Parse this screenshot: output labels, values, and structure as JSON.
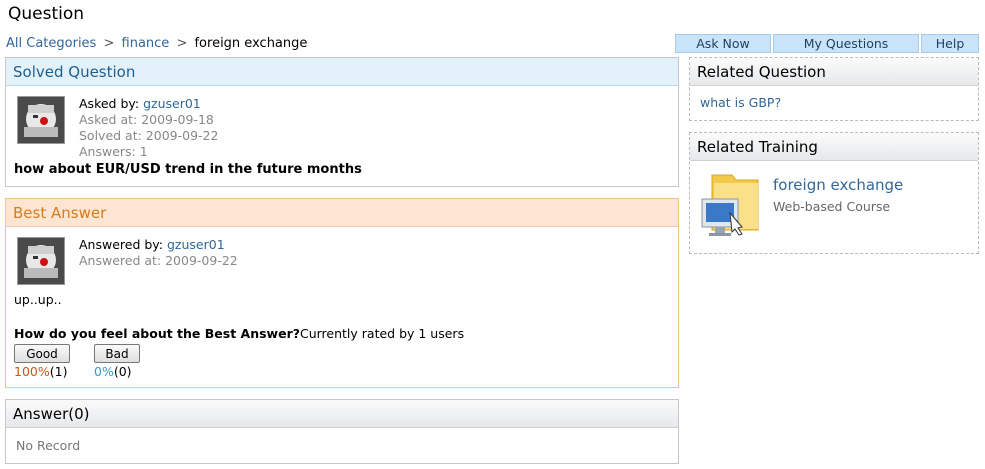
{
  "page": {
    "title": "Question"
  },
  "breadcrumb": {
    "items": [
      "All Categories",
      "finance"
    ],
    "separator": ">",
    "current": "foreign exchange"
  },
  "topnav": {
    "tabs": [
      "Ask Now",
      "My Questions",
      "Help"
    ]
  },
  "question": {
    "header": "Solved Question",
    "asked_by_label": "Asked by:",
    "asked_by_user": "gzuser01",
    "asked_at": "Asked at: 2009-09-18",
    "solved_at": "Solved at: 2009-09-22",
    "answers": "Answers: 1",
    "text": "how about EUR/USD trend in the future months"
  },
  "best_answer": {
    "header": "Best Answer",
    "answered_by_label": "Answered by:",
    "answered_by_user": "gzuser01",
    "answered_at": "Answered at: 2009-09-22",
    "text": "up..up..",
    "rating_question": "How do you feel about the Best Answer?",
    "rating_count": "Currently rated by 1 users",
    "good_label": "Good",
    "good_pct": "100%",
    "good_count": "(1)",
    "bad_label": "Bad",
    "bad_pct": "0%",
    "bad_count": "(0)"
  },
  "answers": {
    "header": "Answer(0)",
    "empty": "No Record"
  },
  "related_question": {
    "header": "Related Question",
    "items": [
      "what is GBP?"
    ]
  },
  "related_training": {
    "header": "Related Training",
    "title": "foreign exchange",
    "type": "Web-based Course"
  },
  "colors": {
    "link": "#336699",
    "good": "#cc5511",
    "bad": "#3399cc",
    "orange_header": "#d97a1e"
  }
}
